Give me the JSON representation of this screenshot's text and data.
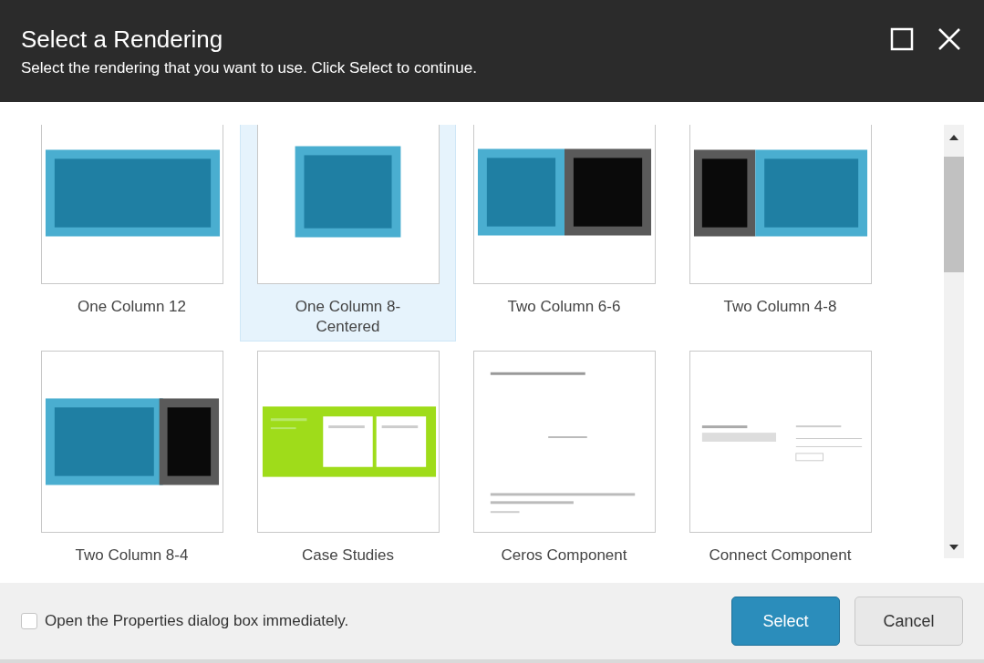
{
  "dialog": {
    "title": "Select a Rendering",
    "subtitle": "Select the rendering that you want to use. Click Select to continue."
  },
  "renderings": [
    {
      "label": "One Column 12",
      "selected": false,
      "kind": "one-col"
    },
    {
      "label": "One Column 8-Centered",
      "selected": true,
      "kind": "centered"
    },
    {
      "label": "Two Column 6-6",
      "selected": false,
      "kind": "six-six"
    },
    {
      "label": "Two Column 4-8",
      "selected": false,
      "kind": "four-eight"
    },
    {
      "label": "Two Column 8-4",
      "selected": false,
      "kind": "eight-four"
    },
    {
      "label": "Case Studies",
      "selected": false,
      "kind": "cards"
    },
    {
      "label": "Ceros Component",
      "selected": false,
      "kind": "text-page"
    },
    {
      "label": "Connect Component",
      "selected": false,
      "kind": "form-page"
    }
  ],
  "option": {
    "label": "Open the Properties dialog box immediately.",
    "checked": false
  },
  "buttons": [
    {
      "label": "Select",
      "kind": "primary"
    },
    {
      "label": "Cancel",
      "kind": "secondary"
    }
  ]
}
